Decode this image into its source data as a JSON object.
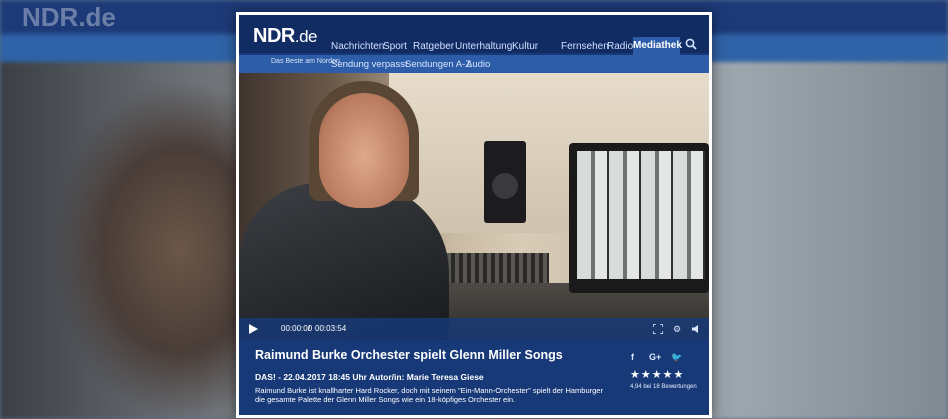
{
  "background": {
    "ghost_logo": "NDR.de"
  },
  "nav": {
    "logo_main": "NDR",
    "logo_suffix": ".de",
    "tagline": "Das Beste am Norden",
    "items": [
      "Nachrichten",
      "Sport",
      "Ratgeber",
      "Unterhaltung",
      "Kultur",
      "Fernsehen",
      "Radio"
    ],
    "active": "Mediathek",
    "sub_items": [
      "Sendung verpasst",
      "Sendungen A-Z",
      "Audio"
    ]
  },
  "player": {
    "current_time": "00:00:00",
    "separator": "/",
    "duration": "00:03:54"
  },
  "info": {
    "title": "Raimund Burke Orchester spielt Glenn Miller Songs",
    "meta": "DAS! - 22.04.2017 18:45 Uhr Autor/in: Marie Teresa Giese",
    "description": "Raimund Burke ist knallharter Hard Rocker, doch mit seinem \"Ein-Mann-Orchester\" spielt der Hamburger die gesamte Palette der Glenn Miller Songs wie ein 18-köpfiges Orchester ein.",
    "social": [
      "f",
      "G+",
      "🐦"
    ],
    "stars": "★★★★★",
    "rating_text": "4,94 bei 18 Bewertungen"
  },
  "colors": {
    "nav_dark": "#112b63",
    "nav_accent": "#2d5da8",
    "panel": "#173977"
  }
}
